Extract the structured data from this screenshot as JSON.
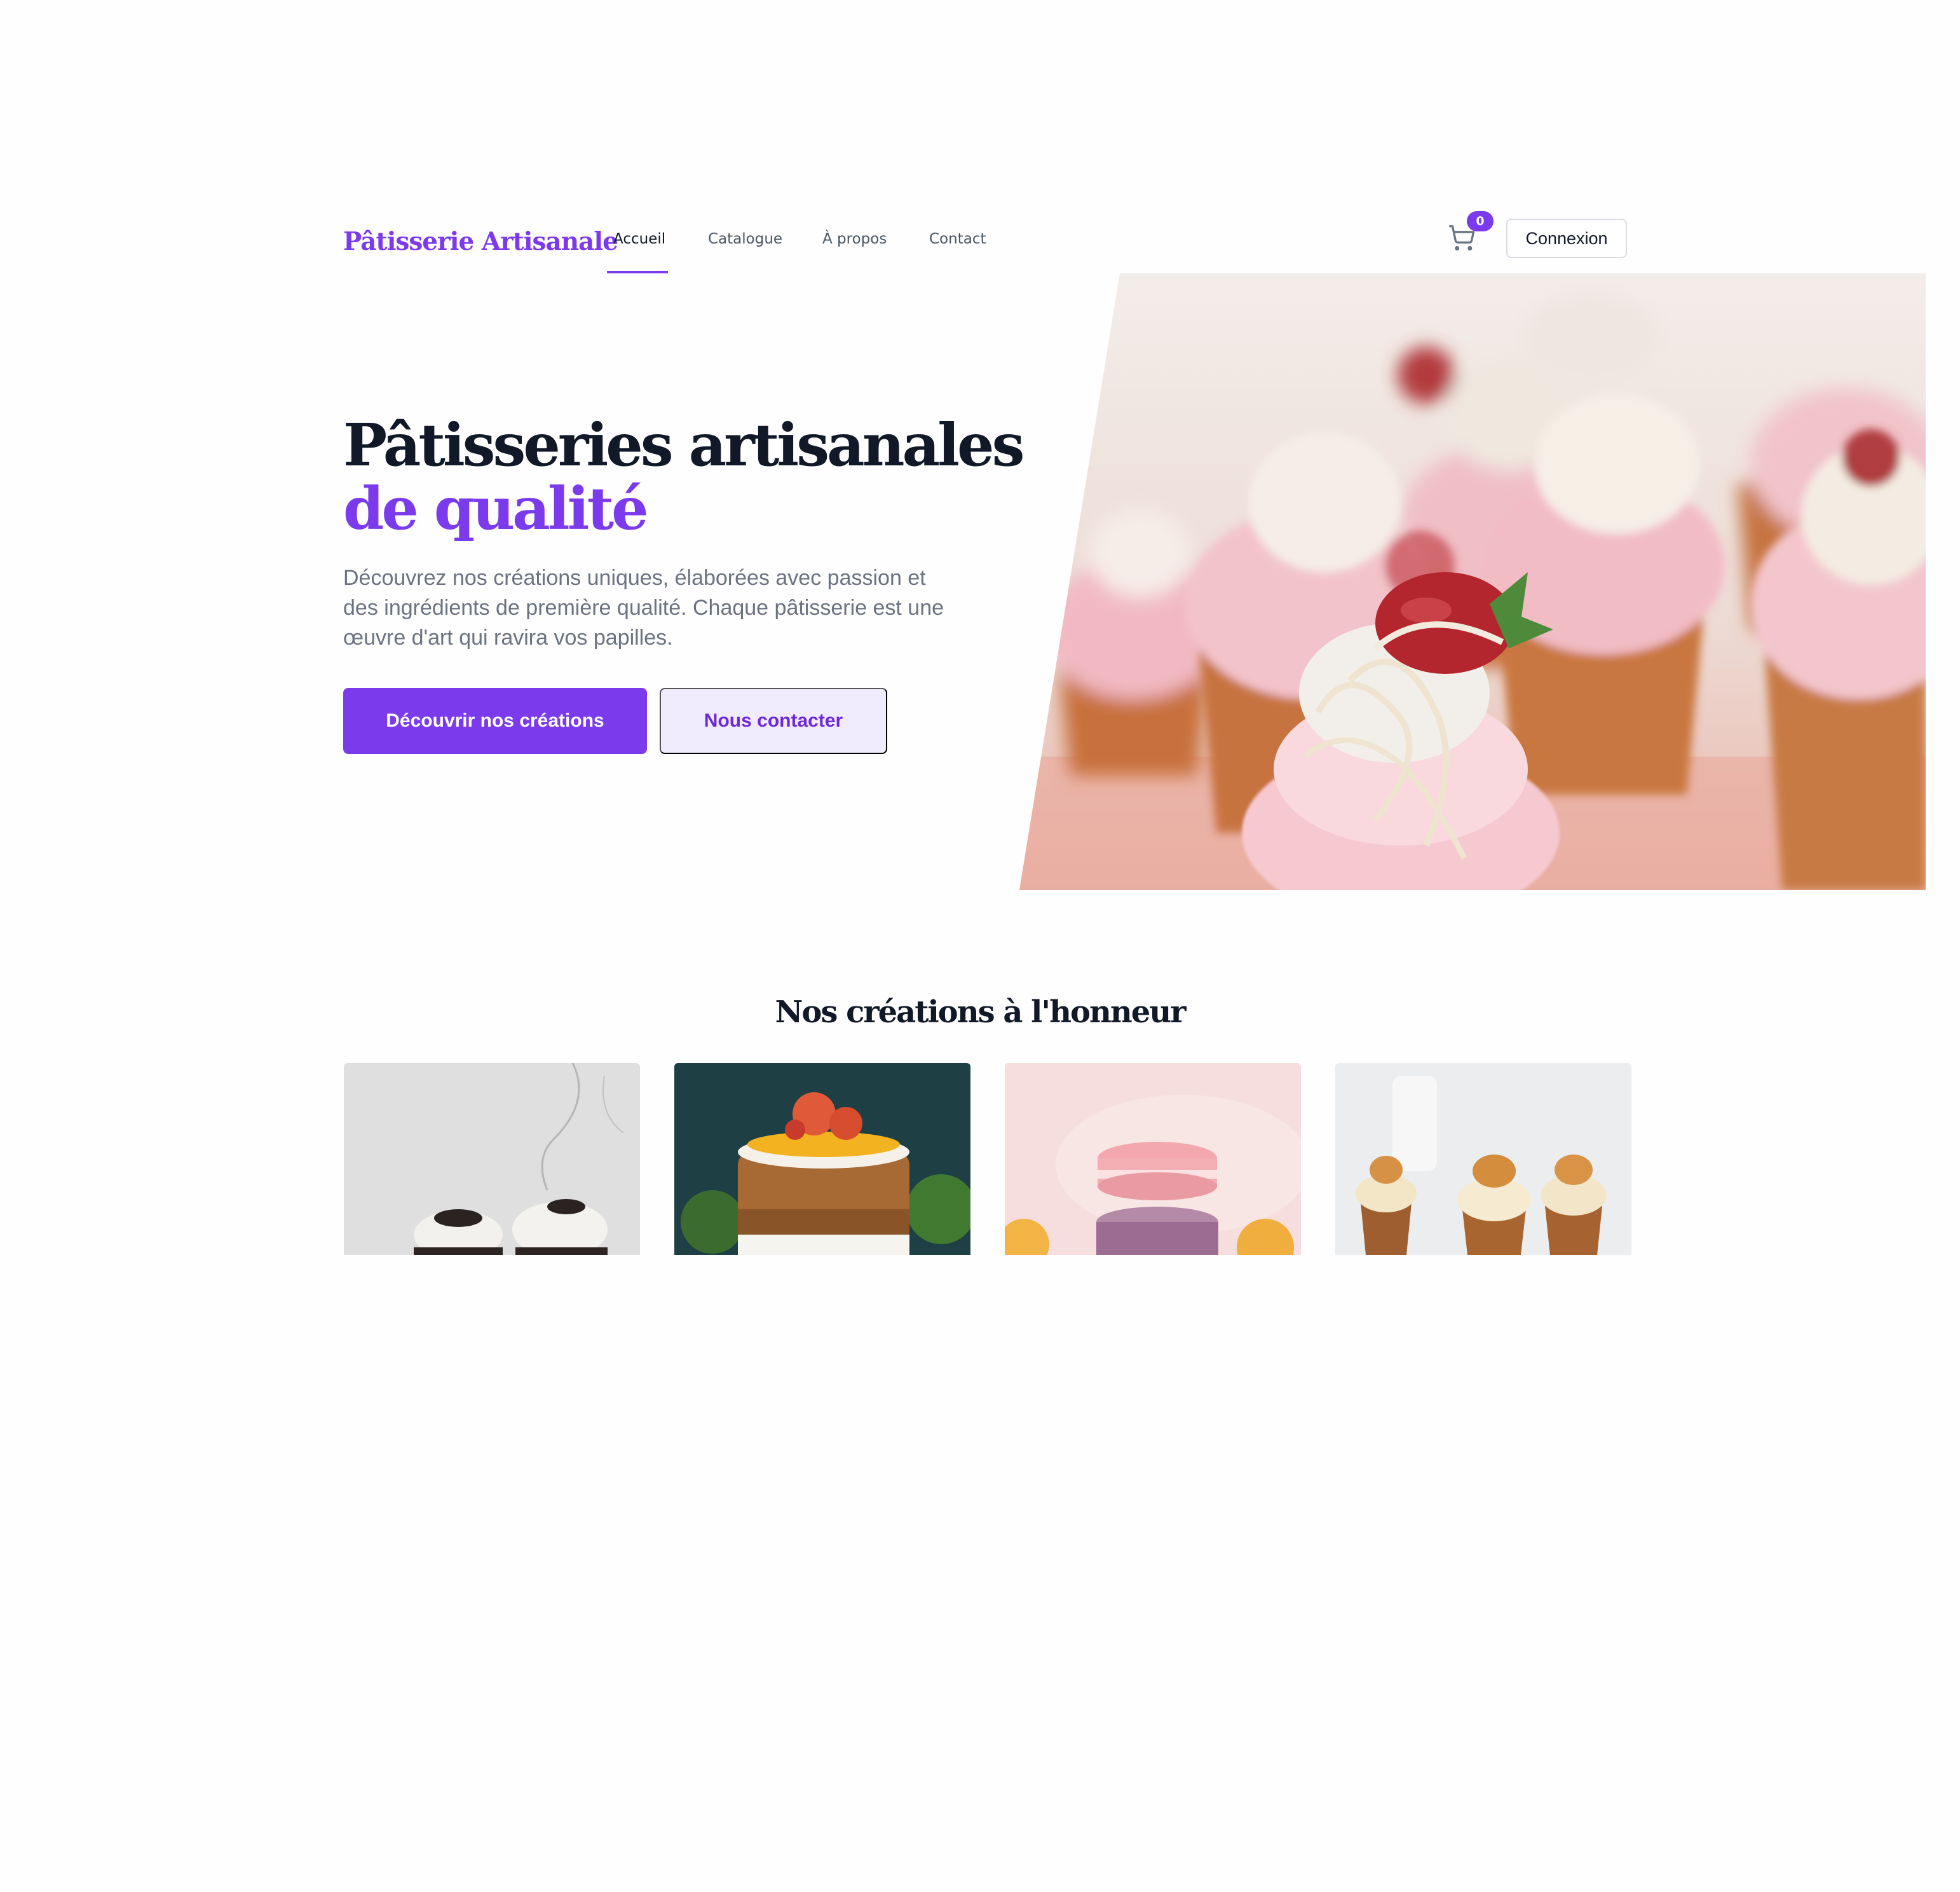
{
  "header": {
    "logo": "Pâtisserie Artisanale",
    "nav": [
      {
        "label": "Accueil",
        "active": true
      },
      {
        "label": "Catalogue",
        "active": false
      },
      {
        "label": "À propos",
        "active": false
      },
      {
        "label": "Contact",
        "active": false
      }
    ],
    "cart_icon": "shopping-cart-icon",
    "cart_count": "0",
    "login_label": "Connexion"
  },
  "hero": {
    "title_line1": "Pâtisseries artisanales",
    "title_line2": "de qualité",
    "description": "Découvrez nos créations uniques, élaborées avec passion et des ingrédients de première qualité. Chaque pâtisserie est une œuvre d'art qui ravira vos papilles.",
    "primary_button": "Découvrir nos créations",
    "secondary_button": "Nous contacter"
  },
  "featured": {
    "title": "Nos créations à l'honneur"
  },
  "colors": {
    "accent": "#7c3aed",
    "accent_light": "#f1ecfd",
    "text_dark": "#111827",
    "text_muted": "#6b7280"
  }
}
